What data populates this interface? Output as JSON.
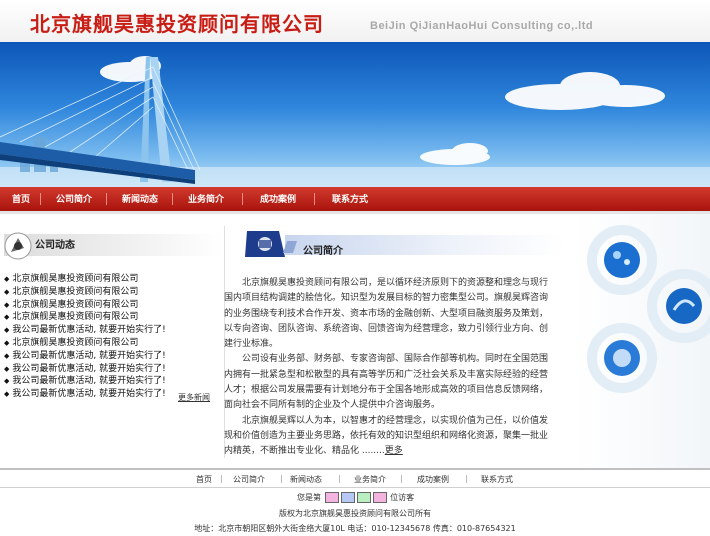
{
  "header": {
    "logo_cn": "北京旗舰昊惠投资顾问有限公司",
    "logo_en": "BeiJin QiJianHaoHui Consulting co,.ltd"
  },
  "nav": {
    "items": [
      "首页",
      "公司简介",
      "新闻动态",
      "业务简介",
      "成功案例",
      "联系方式"
    ]
  },
  "news": {
    "title": "公司动态",
    "items": [
      "北京旗舰昊惠投资顾问有限公司",
      "北京旗舰昊惠投资顾问有限公司",
      "北京旗舰昊惠投资顾问有限公司",
      "北京旗舰昊惠投资顾问有限公司",
      "我公司最新优惠活动, 就要开始实行了!",
      "北京旗舰昊惠投资顾问有限公司",
      "我公司最新优惠活动, 就要开始实行了!",
      "我公司最新优惠活动, 就要开始实行了!",
      "我公司最新优惠活动, 就要开始实行了!",
      "我公司最新优惠活动, 就要开始实行了!"
    ],
    "more": "更多新闻"
  },
  "about": {
    "title": "公司简介",
    "p1": "北京旗舰昊惠投资顾问有限公司，是以循环经济原则下的资源整和理念与现行国内项目结构调建的脍信化。知识型为发展目标的智力密集型公司。旗舰昊辉咨询的业务围绕专利技术合作开发、资本市场的金融创新、大型项目融资服务及策划，以专向咨询、团队咨询、系统咨询、回馈咨询为经营理念，致力引领行业方向、创建行业标准。",
    "p2": "公司设有业务部、财务部、专家咨询部、国际合作部等机构。同时在全国范围内拥有一批紧急型和松散型的具有高等学历和广泛社会关系及丰富实际经验的经营人才；根据公司发展需要有计划地分布于全国各地形成高效的项目信息反馈网络，面向社会不同所有制的企业及个人提供中介咨询服务。",
    "p3": "北京旗舰昊辉以人为本，以智惠才的经营理念，以实现价值为己任，以价值发现和价值创造为主要业务思路，依托有效的知识型组织和网络化资源，聚集一批业内精英，不断推出专业化、精品化 ........",
    "more": "更多"
  },
  "footer": {
    "nav": [
      "首页",
      "公司简介",
      "新闻动态",
      "业务简介",
      "成功案例",
      "联系方式"
    ],
    "visitor_prefix": "您是第",
    "visitor_suffix": "位访客",
    "copyright": "版权为北京旗舰昊惠投资顾问有限公司所有",
    "address": "地址：北京市朝阳区朝外大街金络大厦10L 电话：010-12345678 传真：010-87654321"
  },
  "colors": {
    "brand_red": "#c81d14",
    "nav_red": "#b8201a",
    "sky_blue": "#2f86dc"
  }
}
